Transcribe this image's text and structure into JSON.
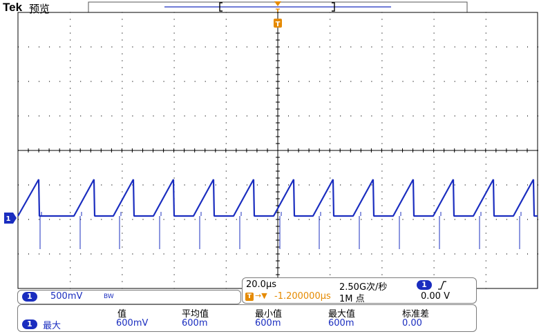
{
  "header": {
    "brand": "Tek",
    "mode": "预览"
  },
  "trigger": {
    "marker_label": "T",
    "position_label": "T",
    "level": "0.00 V",
    "slope_symbol": "⎍",
    "delay_arrow": "→▼",
    "delay": "-1.200000μs",
    "channel": "1"
  },
  "channel1": {
    "label": "1",
    "marker": "1",
    "scale": "500mV",
    "bw_icon": "bandwidth-limit-icon",
    "bw_text": "BW",
    "color": "#1a2dbf"
  },
  "horizontal": {
    "timebase": "20.0μs",
    "sample_rate": "2.50G次/秒",
    "record_length": "1M 点"
  },
  "measurements": {
    "headers": [
      "值",
      "平均值",
      "最小值",
      "最大值",
      "标准差"
    ],
    "rows": [
      {
        "channel": "1",
        "name": "最大",
        "value": "600mV",
        "mean": "600m",
        "min": "600m",
        "max": "600m",
        "std": "0.00"
      }
    ]
  },
  "colors": {
    "waveform": "#1a2dbf",
    "trigger": "#e58a00",
    "grid": "#000000",
    "background": "#ffffff"
  }
}
